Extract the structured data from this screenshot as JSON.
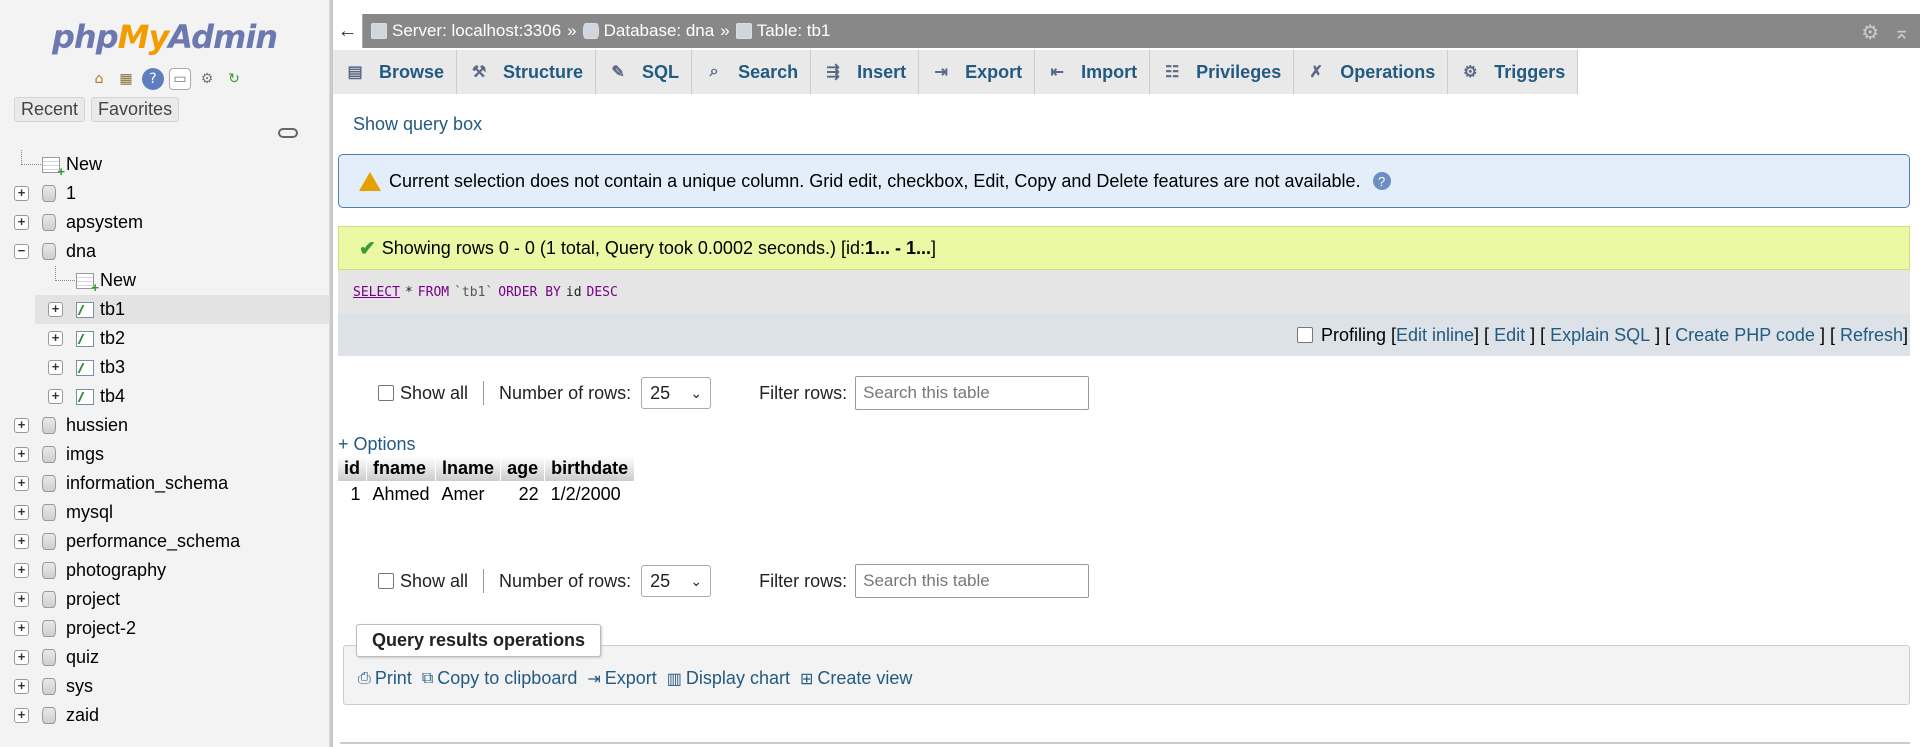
{
  "sidebar": {
    "logo": {
      "php": "php",
      "my": "My",
      "admin": "Admin"
    },
    "nav_icons": [
      "home-icon",
      "database-icon",
      "help-icon",
      "docs-icon",
      "gear-icon",
      "reload-icon"
    ],
    "recent_label": "Recent",
    "favorites_label": "Favorites",
    "tree": [
      {
        "label": "New",
        "type": "new"
      },
      {
        "label": "1",
        "type": "db"
      },
      {
        "label": "apsystem",
        "type": "db"
      },
      {
        "label": "dna",
        "type": "db",
        "expanded": true
      },
      {
        "label": "New",
        "type": "new-child"
      },
      {
        "label": "tb1",
        "type": "table",
        "selected": true
      },
      {
        "label": "tb2",
        "type": "table"
      },
      {
        "label": "tb3",
        "type": "table"
      },
      {
        "label": "tb4",
        "type": "table"
      },
      {
        "label": "hussien",
        "type": "db"
      },
      {
        "label": "imgs",
        "type": "db"
      },
      {
        "label": "information_schema",
        "type": "db"
      },
      {
        "label": "mysql",
        "type": "db"
      },
      {
        "label": "performance_schema",
        "type": "db"
      },
      {
        "label": "photography",
        "type": "db"
      },
      {
        "label": "project",
        "type": "db"
      },
      {
        "label": "project-2",
        "type": "db"
      },
      {
        "label": "quiz",
        "type": "db"
      },
      {
        "label": "sys",
        "type": "db"
      },
      {
        "label": "zaid",
        "type": "db"
      }
    ]
  },
  "topbar": {
    "back": "←",
    "server": "Server: localhost:3306",
    "database": "Database: dna",
    "table": "Table: tb1",
    "separator": "»"
  },
  "tabs": [
    {
      "label": "Browse",
      "icon": "browse-icon",
      "glyph": "▤"
    },
    {
      "label": "Structure",
      "icon": "structure-icon",
      "glyph": "⚒"
    },
    {
      "label": "SQL",
      "icon": "sql-icon",
      "glyph": "✎"
    },
    {
      "label": "Search",
      "icon": "search-icon",
      "glyph": "⌕"
    },
    {
      "label": "Insert",
      "icon": "insert-icon",
      "glyph": "⇶"
    },
    {
      "label": "Export",
      "icon": "export-icon",
      "glyph": "⇥"
    },
    {
      "label": "Import",
      "icon": "import-icon",
      "glyph": "⇤"
    },
    {
      "label": "Privileges",
      "icon": "privileges-icon",
      "glyph": "☷"
    },
    {
      "label": "Operations",
      "icon": "wrench-icon",
      "glyph": "✗"
    },
    {
      "label": "Triggers",
      "icon": "triggers-icon",
      "glyph": "⚙"
    }
  ],
  "main": {
    "show_query_box": "Show query box",
    "notice": "Current selection does not contain a unique column. Grid edit, checkbox, Edit, Copy and Delete features are not available.",
    "success_text": "Showing rows 0 - 0 (1 total, Query took 0.0002 seconds.) [id: ",
    "success_range": "1... - 1...",
    "success_end": "]",
    "sql": {
      "select": "SELECT",
      "star": "*",
      "from": "FROM",
      "table": "`tb1`",
      "order": "ORDER BY",
      "col": "id",
      "dir": "DESC"
    },
    "profiling": "Profiling",
    "sql_links": [
      "Edit inline",
      "Edit",
      "Explain SQL",
      "Create PHP code",
      "Refresh"
    ],
    "nav": {
      "show_all": "Show all",
      "rows_label": "Number of rows:",
      "rows_value": "25",
      "filter_label": "Filter rows:",
      "filter_placeholder": "Search this table"
    },
    "options": "+ Options",
    "table": {
      "headers": [
        "id",
        "fname",
        "lname",
        "age",
        "birthdate"
      ],
      "rows": [
        [
          "1",
          "Ahmed",
          "Amer",
          "22",
          "1/2/2000"
        ]
      ]
    },
    "qro": {
      "title": "Query results operations",
      "links": [
        {
          "label": "Print",
          "icon": "print-icon",
          "glyph": "⎙"
        },
        {
          "label": "Copy to clipboard",
          "icon": "clipboard-icon",
          "glyph": "⧉"
        },
        {
          "label": "Export",
          "icon": "export-icon",
          "glyph": "⇥"
        },
        {
          "label": "Display chart",
          "icon": "chart-icon",
          "glyph": "▥"
        },
        {
          "label": "Create view",
          "icon": "create-view-icon",
          "glyph": "⊞"
        }
      ]
    }
  }
}
